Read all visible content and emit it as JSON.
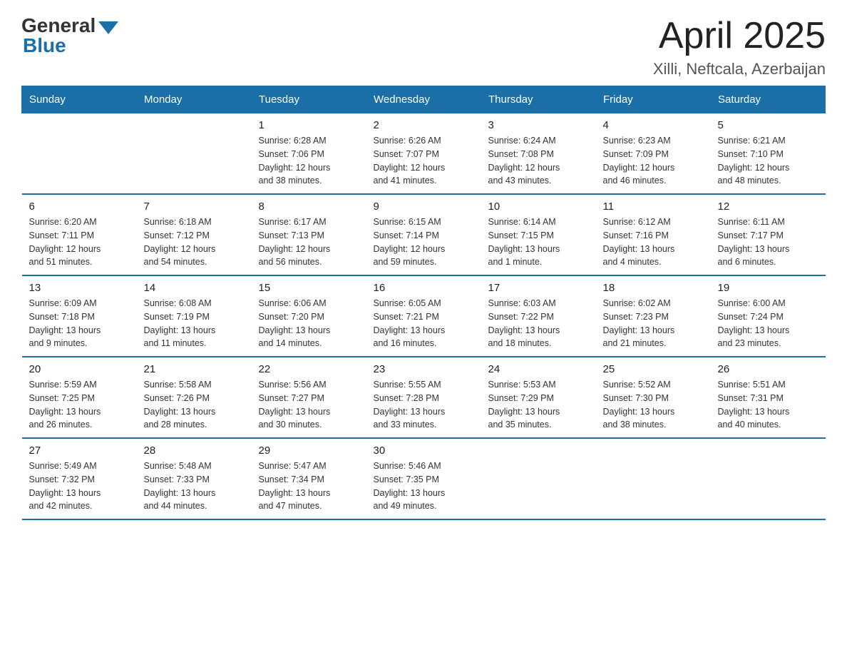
{
  "logo": {
    "general": "General",
    "blue": "Blue"
  },
  "title": "April 2025",
  "subtitle": "Xilli, Neftcala, Azerbaijan",
  "headers": [
    "Sunday",
    "Monday",
    "Tuesday",
    "Wednesday",
    "Thursday",
    "Friday",
    "Saturday"
  ],
  "weeks": [
    [
      {
        "day": "",
        "info": ""
      },
      {
        "day": "",
        "info": ""
      },
      {
        "day": "1",
        "info": "Sunrise: 6:28 AM\nSunset: 7:06 PM\nDaylight: 12 hours\nand 38 minutes."
      },
      {
        "day": "2",
        "info": "Sunrise: 6:26 AM\nSunset: 7:07 PM\nDaylight: 12 hours\nand 41 minutes."
      },
      {
        "day": "3",
        "info": "Sunrise: 6:24 AM\nSunset: 7:08 PM\nDaylight: 12 hours\nand 43 minutes."
      },
      {
        "day": "4",
        "info": "Sunrise: 6:23 AM\nSunset: 7:09 PM\nDaylight: 12 hours\nand 46 minutes."
      },
      {
        "day": "5",
        "info": "Sunrise: 6:21 AM\nSunset: 7:10 PM\nDaylight: 12 hours\nand 48 minutes."
      }
    ],
    [
      {
        "day": "6",
        "info": "Sunrise: 6:20 AM\nSunset: 7:11 PM\nDaylight: 12 hours\nand 51 minutes."
      },
      {
        "day": "7",
        "info": "Sunrise: 6:18 AM\nSunset: 7:12 PM\nDaylight: 12 hours\nand 54 minutes."
      },
      {
        "day": "8",
        "info": "Sunrise: 6:17 AM\nSunset: 7:13 PM\nDaylight: 12 hours\nand 56 minutes."
      },
      {
        "day": "9",
        "info": "Sunrise: 6:15 AM\nSunset: 7:14 PM\nDaylight: 12 hours\nand 59 minutes."
      },
      {
        "day": "10",
        "info": "Sunrise: 6:14 AM\nSunset: 7:15 PM\nDaylight: 13 hours\nand 1 minute."
      },
      {
        "day": "11",
        "info": "Sunrise: 6:12 AM\nSunset: 7:16 PM\nDaylight: 13 hours\nand 4 minutes."
      },
      {
        "day": "12",
        "info": "Sunrise: 6:11 AM\nSunset: 7:17 PM\nDaylight: 13 hours\nand 6 minutes."
      }
    ],
    [
      {
        "day": "13",
        "info": "Sunrise: 6:09 AM\nSunset: 7:18 PM\nDaylight: 13 hours\nand 9 minutes."
      },
      {
        "day": "14",
        "info": "Sunrise: 6:08 AM\nSunset: 7:19 PM\nDaylight: 13 hours\nand 11 minutes."
      },
      {
        "day": "15",
        "info": "Sunrise: 6:06 AM\nSunset: 7:20 PM\nDaylight: 13 hours\nand 14 minutes."
      },
      {
        "day": "16",
        "info": "Sunrise: 6:05 AM\nSunset: 7:21 PM\nDaylight: 13 hours\nand 16 minutes."
      },
      {
        "day": "17",
        "info": "Sunrise: 6:03 AM\nSunset: 7:22 PM\nDaylight: 13 hours\nand 18 minutes."
      },
      {
        "day": "18",
        "info": "Sunrise: 6:02 AM\nSunset: 7:23 PM\nDaylight: 13 hours\nand 21 minutes."
      },
      {
        "day": "19",
        "info": "Sunrise: 6:00 AM\nSunset: 7:24 PM\nDaylight: 13 hours\nand 23 minutes."
      }
    ],
    [
      {
        "day": "20",
        "info": "Sunrise: 5:59 AM\nSunset: 7:25 PM\nDaylight: 13 hours\nand 26 minutes."
      },
      {
        "day": "21",
        "info": "Sunrise: 5:58 AM\nSunset: 7:26 PM\nDaylight: 13 hours\nand 28 minutes."
      },
      {
        "day": "22",
        "info": "Sunrise: 5:56 AM\nSunset: 7:27 PM\nDaylight: 13 hours\nand 30 minutes."
      },
      {
        "day": "23",
        "info": "Sunrise: 5:55 AM\nSunset: 7:28 PM\nDaylight: 13 hours\nand 33 minutes."
      },
      {
        "day": "24",
        "info": "Sunrise: 5:53 AM\nSunset: 7:29 PM\nDaylight: 13 hours\nand 35 minutes."
      },
      {
        "day": "25",
        "info": "Sunrise: 5:52 AM\nSunset: 7:30 PM\nDaylight: 13 hours\nand 38 minutes."
      },
      {
        "day": "26",
        "info": "Sunrise: 5:51 AM\nSunset: 7:31 PM\nDaylight: 13 hours\nand 40 minutes."
      }
    ],
    [
      {
        "day": "27",
        "info": "Sunrise: 5:49 AM\nSunset: 7:32 PM\nDaylight: 13 hours\nand 42 minutes."
      },
      {
        "day": "28",
        "info": "Sunrise: 5:48 AM\nSunset: 7:33 PM\nDaylight: 13 hours\nand 44 minutes."
      },
      {
        "day": "29",
        "info": "Sunrise: 5:47 AM\nSunset: 7:34 PM\nDaylight: 13 hours\nand 47 minutes."
      },
      {
        "day": "30",
        "info": "Sunrise: 5:46 AM\nSunset: 7:35 PM\nDaylight: 13 hours\nand 49 minutes."
      },
      {
        "day": "",
        "info": ""
      },
      {
        "day": "",
        "info": ""
      },
      {
        "day": "",
        "info": ""
      }
    ]
  ]
}
